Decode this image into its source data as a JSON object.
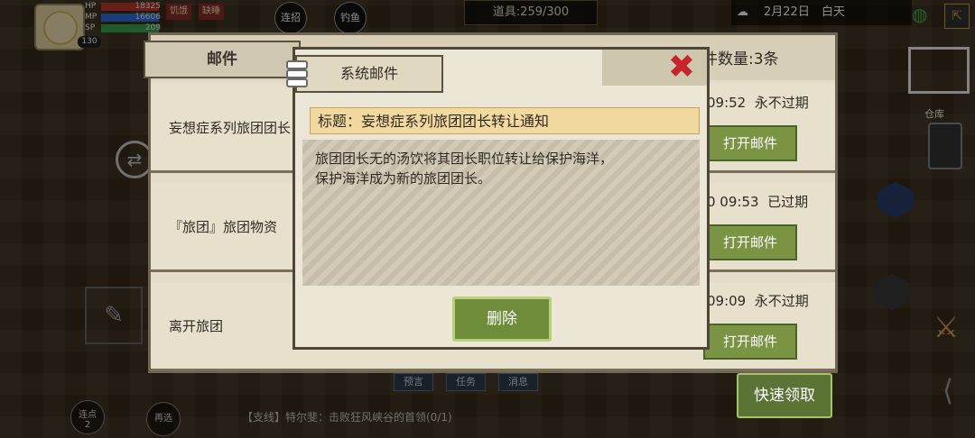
{
  "hud": {
    "hp_label": "HP",
    "hp_value": "18325",
    "mp_label": "MP",
    "mp_value": "16606",
    "sp_label": "SP",
    "sp_value": "209",
    "level": "130",
    "tab_hunger": "饥饿",
    "tab_thirst": "缺睡",
    "combo_label": "连招",
    "fishing_label": "钓鱼",
    "items_label": "道具:259/300",
    "date": "2月22日",
    "daytime": "白天",
    "warehouse_label": "仓库"
  },
  "mail_panel": {
    "tab_label": "邮件",
    "count_label": "邮件数量:3条",
    "rows": [
      {
        "title": "妄想症系列旅团团长",
        "time": "09:52",
        "expiry": "永不过期",
        "button": "打开邮件"
      },
      {
        "title": "『旅团』旅团物资",
        "time": "0 09:53",
        "expiry": "已过期",
        "button": "打开邮件"
      },
      {
        "title": "离开旅团",
        "time": "09:09",
        "expiry": "永不过期",
        "button": "打开邮件"
      }
    ]
  },
  "dialog": {
    "tab_label": "系统邮件",
    "subject": "标题：妄想症系列旅团团长转让通知",
    "body_line1": "旅团团长无的汤饮将其团长职位转让给保护海洋，",
    "body_line2": "保护海洋成为新的旅团团长。",
    "delete_label": "删除"
  },
  "bottom": {
    "quick_claim_label": "快速领取",
    "combo_btn_label": "连点",
    "combo_btn_count": "2",
    "reselect_label": "再选",
    "quest_text": "【支线】特尔斐：击败狂风峡谷的首领(0/1)",
    "chat_tabs": [
      "预言",
      "任务",
      "消息"
    ]
  },
  "colors": {
    "accent_green": "#7a9444",
    "close_red": "#c8242c",
    "subject_bg": "#f2d9a0"
  }
}
